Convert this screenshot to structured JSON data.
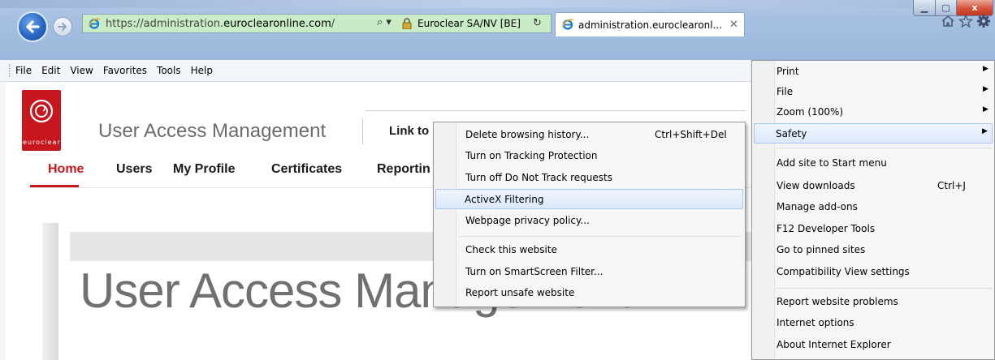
{
  "window": {
    "min_glyph": "▁",
    "max_glyph": "▢",
    "close_glyph": "x"
  },
  "address_bar": {
    "url_scheme": "https://",
    "url_sub": "administration.",
    "url_host": "euroclearonline.com",
    "url_path": "/",
    "certificate": "Euroclear SA/NV [BE]",
    "search_glyph": "⌕ ▾",
    "refresh_glyph": "↻"
  },
  "tab": {
    "label": "administration.euroclearonl...",
    "close_glyph": "✕"
  },
  "menubar": {
    "items": [
      "File",
      "Edit",
      "View",
      "Favorites",
      "Tools",
      "Help"
    ]
  },
  "page": {
    "logo_text": "euroclear",
    "app_title": "User Access Management",
    "link_text": "Link to",
    "nav": [
      "Home",
      "Users",
      "My Profile",
      "Certificates",
      "Reportin"
    ],
    "big_title": "User Access Management"
  },
  "tools_menu": {
    "items": [
      {
        "label": "Print",
        "arrow": "▶"
      },
      {
        "label": "File",
        "arrow": "▶"
      },
      {
        "label": "Zoom (100%)",
        "arrow": "▶"
      },
      {
        "label": "Safety",
        "arrow": "▶"
      },
      {
        "label": "Add site to Start menu"
      },
      {
        "label": "View downloads",
        "shortcut": "Ctrl+J"
      },
      {
        "label": "Manage add-ons"
      },
      {
        "label": "F12 Developer Tools"
      },
      {
        "label": "Go to pinned sites"
      },
      {
        "label": "Compatibility View settings"
      },
      {
        "label": "Report website problems"
      },
      {
        "label": "Internet options"
      },
      {
        "label": "About Internet Explorer"
      }
    ]
  },
  "safety_menu": {
    "items": [
      {
        "label": "Delete browsing history...",
        "shortcut": "Ctrl+Shift+Del"
      },
      {
        "label": "Turn on Tracking Protection"
      },
      {
        "label": "Turn off Do Not Track requests"
      },
      {
        "label": "ActiveX Filtering"
      },
      {
        "label": "Webpage privacy policy..."
      },
      {
        "label": "Check this website"
      },
      {
        "label": "Turn on SmartScreen Filter..."
      },
      {
        "label": "Report unsafe website"
      }
    ]
  },
  "colors": {
    "brand_red": "#c7161d",
    "address_green": "#c9ecc6",
    "highlight": "#dce8fb"
  }
}
